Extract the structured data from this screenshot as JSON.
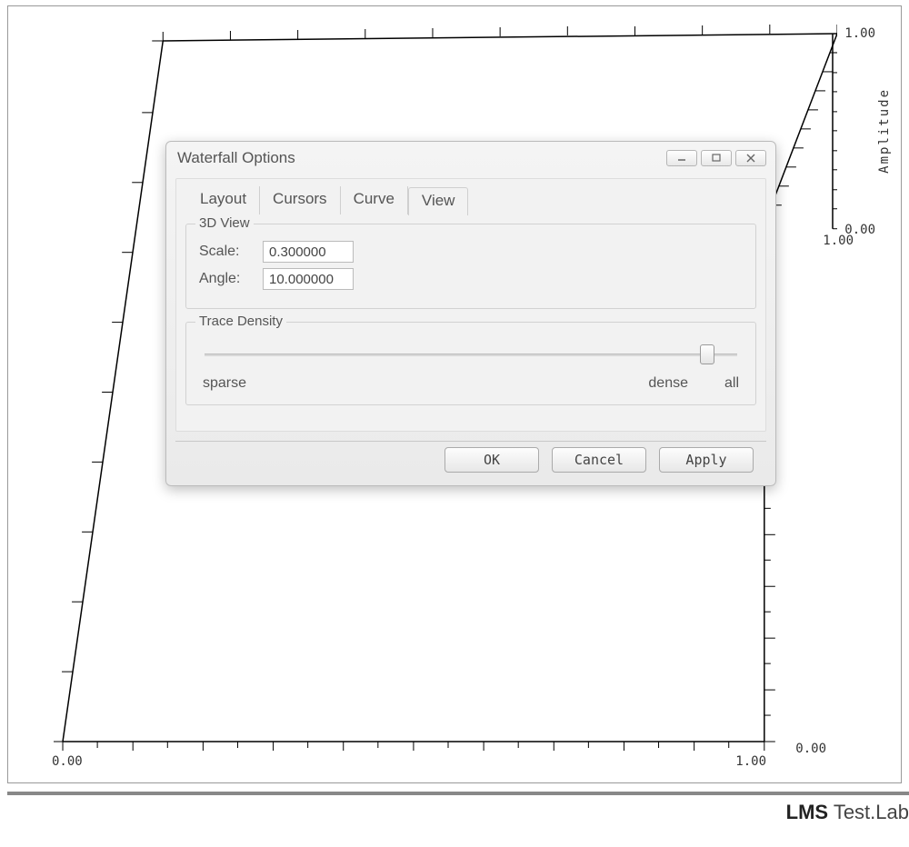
{
  "plot": {
    "x_min": "0.00",
    "x_max": "1.00",
    "z_min": "0.00",
    "z_max": "1.00",
    "y_min": "0.00",
    "y_max": "1.00",
    "y_label": "Amplitude"
  },
  "dialog": {
    "title": "Waterfall Options",
    "tabs": {
      "layout": "Layout",
      "cursors": "Cursors",
      "curve": "Curve",
      "view": "View"
    },
    "active_tab": "view",
    "view": {
      "group_3d_label": "3D View",
      "scale_label": "Scale:",
      "scale_value": "0.300000",
      "angle_label": "Angle:",
      "angle_value": "10.000000",
      "density_label": "Trace Density",
      "density_min_label": "sparse",
      "density_mid_label": "dense",
      "density_max_label": "all",
      "density_position_pct": 93
    },
    "buttons": {
      "ok": "OK",
      "cancel": "Cancel",
      "apply": "Apply"
    }
  },
  "footer": {
    "brand_bold": "LMS",
    "brand_rest": " Test.Lab"
  }
}
